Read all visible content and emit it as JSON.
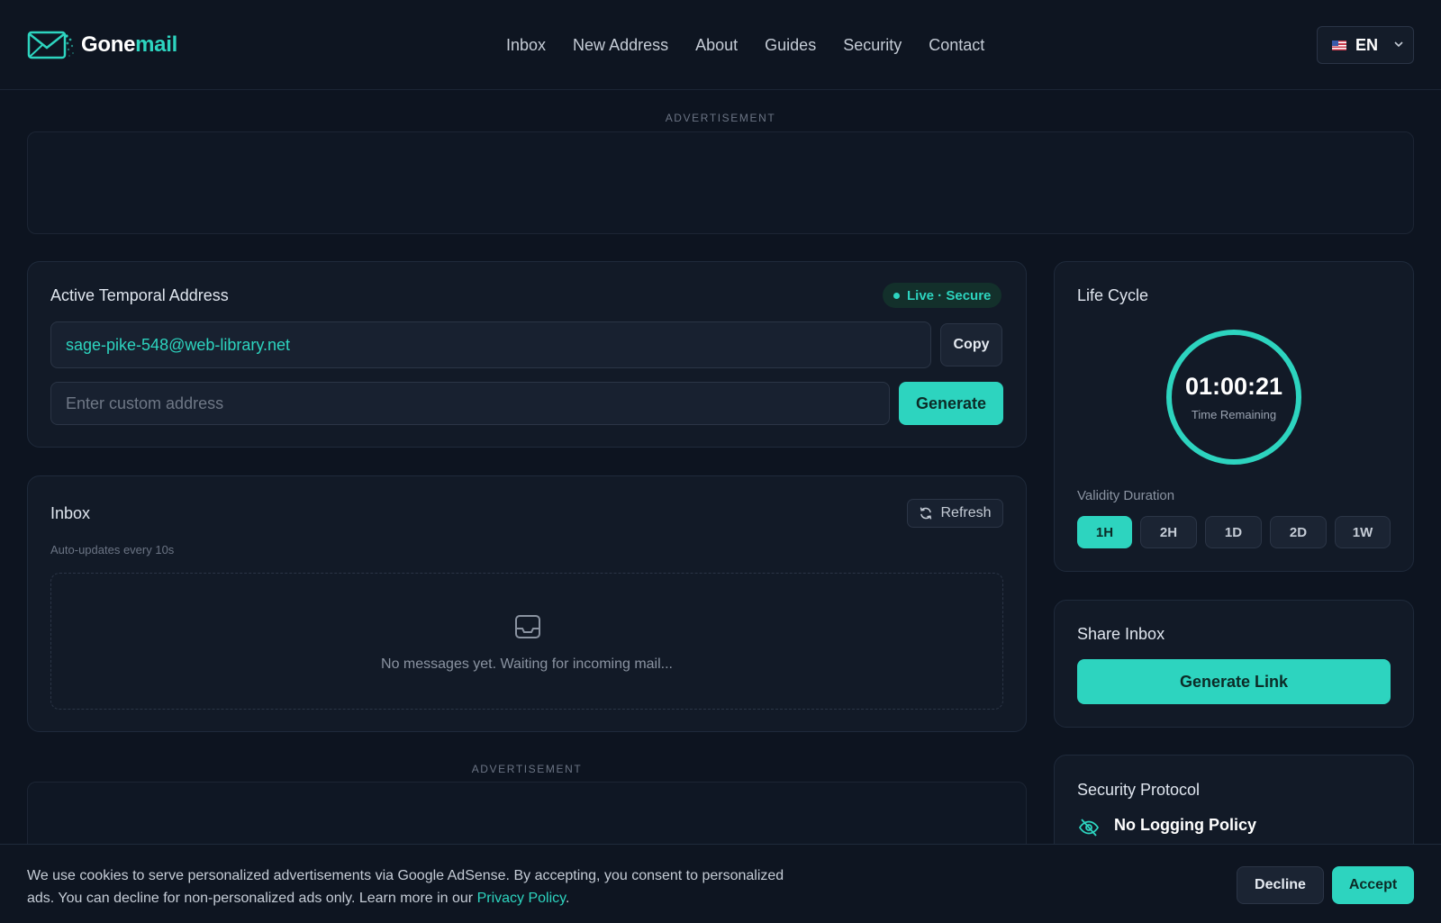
{
  "brand": {
    "name_part1": "Gone",
    "name_part2": "mail",
    "accent": "#2dd4bf"
  },
  "nav": {
    "items": [
      "Inbox",
      "New Address",
      "About",
      "Guides",
      "Security",
      "Contact"
    ]
  },
  "language": {
    "code": "EN",
    "flag_icon": "us-flag-icon"
  },
  "ads": {
    "top_label": "ADVERTISEMENT",
    "bottom_label": "ADVERTISEMENT"
  },
  "address_card": {
    "title": "Active Temporal Address",
    "status": "Live · Secure",
    "email": "sage-pike-548@web-library.net",
    "copy_label": "Copy",
    "custom_placeholder": "Enter custom address",
    "generate_label": "Generate"
  },
  "inbox": {
    "title": "Inbox",
    "refresh_label": "Refresh",
    "note": "Auto-updates every 10s",
    "empty_text": "No messages yet. Waiting for incoming mail..."
  },
  "lifecycle": {
    "title": "Life Cycle",
    "timer": "01:00:21",
    "timer_label": "Time Remaining",
    "duration_label": "Validity Duration",
    "durations": [
      "1H",
      "2H",
      "1D",
      "2D",
      "1W"
    ],
    "selected": "1H"
  },
  "share": {
    "title": "Share Inbox",
    "button_label": "Generate Link"
  },
  "security": {
    "title": "Security Protocol",
    "policy_title": "No Logging Policy"
  },
  "cookie": {
    "text": "We use cookies to serve personalized advertisements via Google AdSense. By accepting, you consent to personalized ads. You can decline for non-personalized ads only. Learn more in our ",
    "link": "Privacy Policy",
    "end": ".",
    "decline_label": "Decline",
    "accept_label": "Accept"
  }
}
